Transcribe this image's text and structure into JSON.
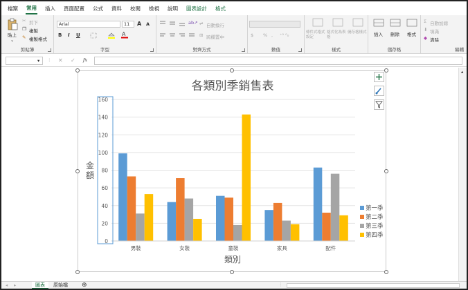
{
  "menu": {
    "tabs": [
      "檔案",
      "常用",
      "插入",
      "頁面配置",
      "公式",
      "資料",
      "校閱",
      "檢視",
      "說明",
      "圖表設計",
      "格式"
    ],
    "active_index": 1
  },
  "ribbon": {
    "clipboard": {
      "paste": "貼上",
      "cut": "剪下",
      "copy": "複製",
      "format_painter": "複製格式",
      "label": "剪貼簿"
    },
    "font": {
      "name": "Arial",
      "size": "11",
      "label": "字型",
      "grow": "A",
      "shrink": "A",
      "bold": "B",
      "italic": "I",
      "underline": "U"
    },
    "alignment": {
      "wrap": "自動換行",
      "merge": "跨欄置中",
      "label": "對齊方式"
    },
    "number": {
      "percent": "%",
      "label": "數值"
    },
    "styles": {
      "cond": "條件式格式設定",
      "table": "格式化為表格",
      "cell": "儲存格樣式",
      "label": "樣式"
    },
    "cells": {
      "insert": "插入",
      "delete": "刪除",
      "format": "格式",
      "label": "儲存格"
    },
    "editing": {
      "autosum": "自動加總",
      "fill": "填滿",
      "clear": "清除",
      "label": "編輯"
    }
  },
  "formula_bar": {
    "fx": "fx",
    "cancel": "✕",
    "enter": "✓"
  },
  "chart_data": {
    "type": "bar",
    "title": "各類別季銷售表",
    "xlabel": "類別",
    "ylabel": "金額",
    "categories": [
      "男裝",
      "女裝",
      "童裝",
      "家具",
      "配件"
    ],
    "ylim": [
      0,
      160
    ],
    "yticks": [
      "0",
      "20",
      "40",
      "60",
      "80",
      "100",
      "120",
      "140",
      "160"
    ],
    "grid": true,
    "legend_position": "right",
    "series": [
      {
        "name": "第一季",
        "color": "#5b9bd5",
        "values": [
          99,
          44,
          51,
          35,
          83
        ]
      },
      {
        "name": "第二季",
        "color": "#ed7d31",
        "values": [
          73,
          71,
          49,
          43,
          32
        ]
      },
      {
        "name": "第三季",
        "color": "#a5a5a5",
        "values": [
          31,
          48,
          18,
          23,
          76
        ]
      },
      {
        "name": "第四季",
        "color": "#ffc000",
        "values": [
          53,
          25,
          143,
          19,
          29
        ]
      }
    ]
  },
  "sheet_tabs": {
    "tabs": [
      "圖表",
      "原始檔"
    ],
    "active_index": 0
  }
}
